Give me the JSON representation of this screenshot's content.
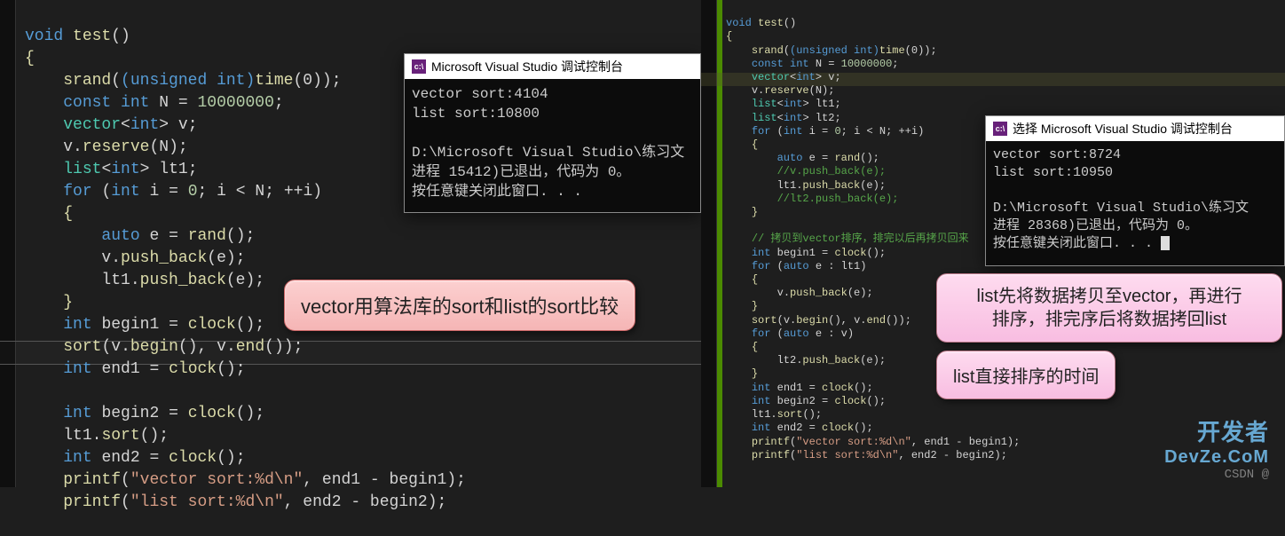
{
  "left": {
    "code": {
      "void": "void",
      "test": "test",
      "paren": "()",
      "srand": "srand",
      "uint_cast": "(unsigned int)",
      "time": "time",
      "zero_call": "(0)",
      "semi": ";",
      "const": "const",
      "int": "int",
      "N": "N",
      "eq": " = ",
      "N_val": "10000000",
      "vector": "vector",
      "lt": "<",
      "gt": ">",
      "v": "v",
      "reserve": "reserve",
      "Narg": "(N)",
      "list": "list",
      "lt1": "lt1",
      "for": "for",
      "i": "i",
      "zero": "0",
      "ltop": "<",
      "inc": "++i",
      "auto": "auto",
      "e": "e",
      "rand": "rand",
      "push_back": "push_back",
      "earg": "(e)",
      "begin1": "begin1",
      "clock": "clock",
      "sort": "sort",
      "begin": "begin",
      "end": "end",
      "end1": "end1",
      "begin2": "begin2",
      "ltsort": "sort",
      "end2": "end2",
      "printf": "printf",
      "fmt_vec": "\"vector sort:%d\\n\"",
      "fmt_list": "\"list sort:%d\\n\"",
      "minus": " - "
    },
    "console": {
      "title": "Microsoft Visual Studio 调试控制台",
      "l1": "vector sort:4104",
      "l2": "list sort:10800",
      "l3": "",
      "l4": "D:\\Microsoft Visual Studio\\练习文",
      "l5": "进程 15412)已退出，代码为 0。",
      "l6": "按任意键关闭此窗口. . ."
    },
    "callout": "vector用算法库的sort和list的sort比较"
  },
  "right": {
    "code": {
      "void": "void",
      "test": "test",
      "srand": "srand",
      "uint_cast": "(unsigned int)",
      "time": "time",
      "const": "const",
      "int": "int",
      "N": "N",
      "N_val": "10000000",
      "vector": "vector",
      "v": "v",
      "reserve": "reserve",
      "list": "list",
      "lt1": "lt1",
      "lt2": "lt2",
      "for": "for",
      "i": "i",
      "inc": "++i",
      "auto": "auto",
      "e": "e",
      "rand": "rand",
      "vpb_cmt": "//v.push_back(e);",
      "push_back": "push_back",
      "lt2pb_cmt": "//lt2.push_back(e);",
      "cmt_copy": "// 拷贝到vector排序，排完以后再拷贝回来",
      "begin1": "begin1",
      "clock": "clock",
      "for_auto_lt1": "for",
      "colon": " : ",
      "sort": "sort",
      "begin": "begin",
      "end": "end",
      "end1": "end1",
      "begin2": "begin2",
      "ltsort": "sort",
      "end2": "end2",
      "printf": "printf",
      "fmt_vec": "\"vector sort:%d\\n\"",
      "fmt_list": "\"list sort:%d\\n\""
    },
    "console": {
      "title": "选择 Microsoft Visual Studio 调试控制台",
      "l1": "vector sort:8724",
      "l2": "list sort:10950",
      "l3": "",
      "l4": "D:\\Microsoft Visual Studio\\练习文",
      "l5": "进程 28368)已退出，代码为 0。",
      "l6": "按任意键关闭此窗口. . . "
    },
    "callout1_a": "list先将数据拷贝至vector，再进行",
    "callout1_b": "排序，排完序后将数据拷回list",
    "callout2": "list直接排序的时间"
  },
  "watermark": {
    "line1": "开发者",
    "line2": "DevZe.CoM",
    "csdn": "CSDN @"
  }
}
